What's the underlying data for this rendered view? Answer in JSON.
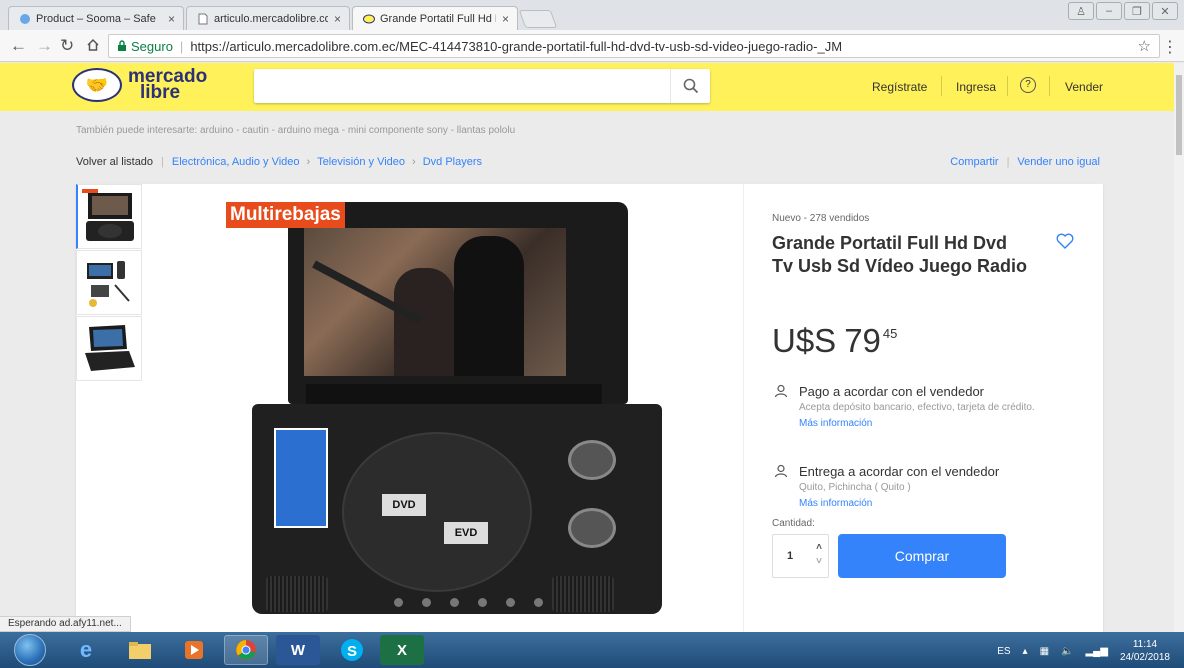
{
  "browser": {
    "tabs": [
      {
        "title": "Product – Sooma – Safe",
        "active": false
      },
      {
        "title": "articulo.mercadolibre.co",
        "active": false
      },
      {
        "title": "Grande Portatil Full Hd D",
        "active": true
      }
    ],
    "secure_label": "Seguro",
    "url": "https://articulo.mercadolibre.com.ec/MEC-414473810-grande-portatil-full-hd-dvd-tv-usb-sd-video-juego-radio-_JM",
    "status_text": "Esperando ad.afy11.net..."
  },
  "header": {
    "logo_line1": "mercado",
    "logo_line2": "libre",
    "search_placeholder": "",
    "nav": {
      "register": "Regístrate",
      "login": "Ingresa",
      "help": "?",
      "sell": "Vender"
    },
    "brand_color": "#fff159"
  },
  "related": "También puede interesarte: arduino - cautin - arduino mega - mini componente sony - llantas pololu",
  "breadcrumb": {
    "back": "Volver al listado",
    "items": [
      "Electrónica, Audio y Video",
      "Televisión y Video",
      "Dvd Players"
    ],
    "share": "Compartir",
    "sell_same": "Vender uno igual"
  },
  "gallery": {
    "badge": "Multirebajas",
    "disc_label_1": "DVD",
    "disc_label_2": "EVD"
  },
  "product": {
    "condition": "Nuevo - 278 vendidos",
    "title": "Grande Portatil Full Hd Dvd Tv Usb Sd Vídeo Juego Radio",
    "currency": "U$S",
    "price_int": "79",
    "price_cents": "45",
    "payment": {
      "title": "Pago a acordar con el vendedor",
      "desc": "Acepta depósito bancario, efectivo, tarjeta de crédito.",
      "more": "Más información"
    },
    "shipping": {
      "title": "Entrega a acordar con el vendedor",
      "desc": "Quito, Pichincha ( Quito )",
      "more": "Más información"
    },
    "quantity_label": "Cantidad:",
    "quantity": "1",
    "buy_label": "Comprar",
    "accent": "#3483fa"
  },
  "taskbar": {
    "lang": "ES",
    "time": "11:14",
    "date": "24/02/2018"
  }
}
